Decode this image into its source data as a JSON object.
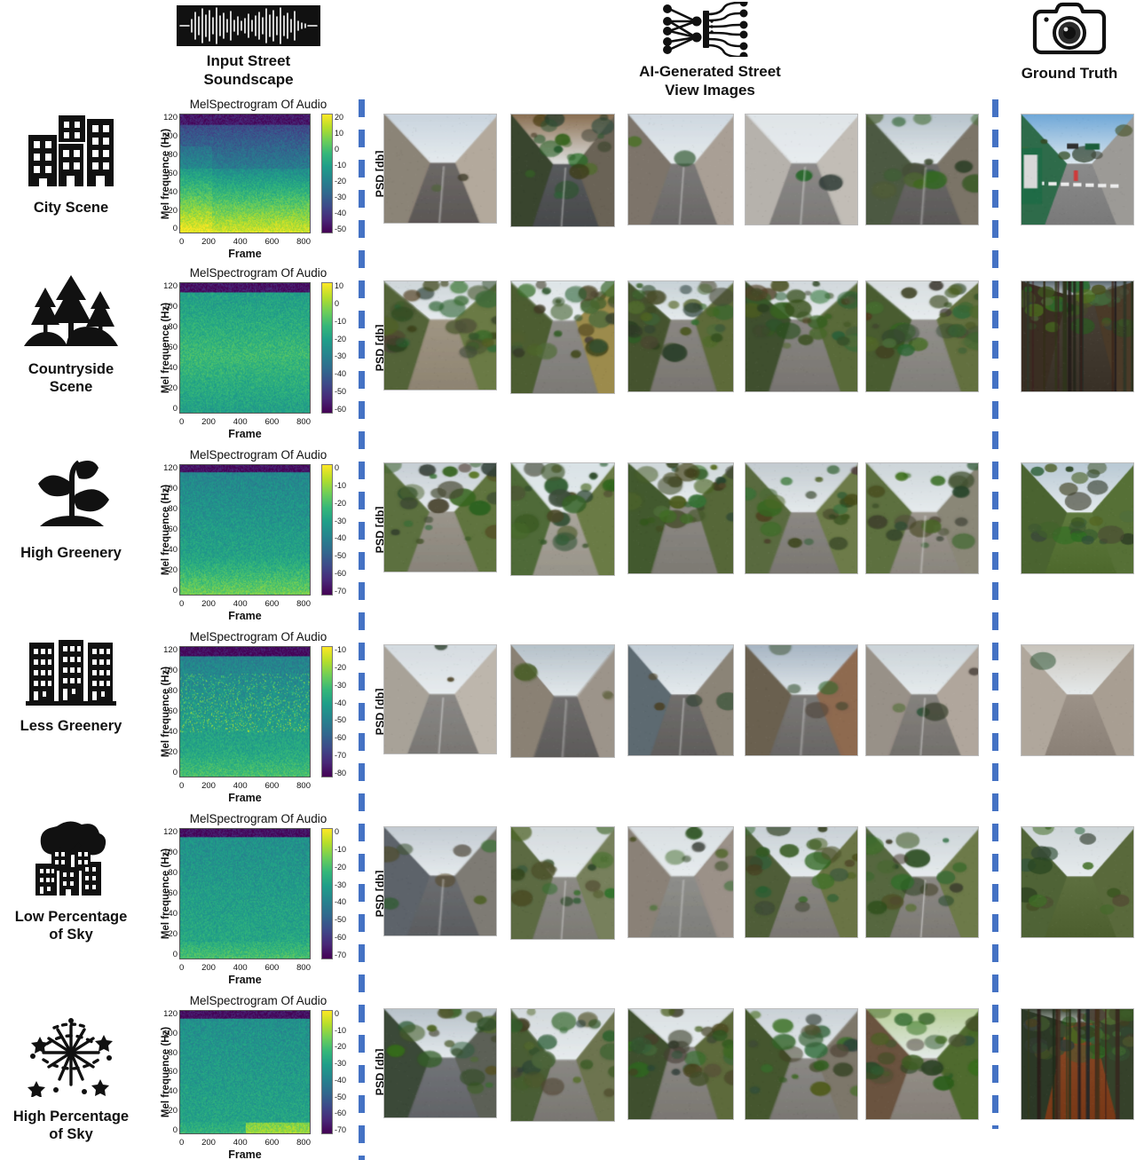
{
  "headers": [
    {
      "id": "input-audio",
      "icon": "audio-waveform-icon",
      "title": "Input Street\nSoundscape"
    },
    {
      "id": "ai-generated",
      "icon": "neural-network-icon",
      "title": "AI-Generated Street\nView Images"
    },
    {
      "id": "ground-truth",
      "icon": "camera-icon",
      "title": "Ground Truth"
    }
  ],
  "spectrogram_common": {
    "title": "MelSpectrogram Of Audio",
    "ylabel": "Mel frequence (Hz)",
    "xlabel": "Frame",
    "cbar_label": "PSD [db]",
    "yticks": [
      "120",
      "100",
      "80",
      "60",
      "40",
      "20",
      "0"
    ],
    "xticks": [
      "0",
      "200",
      "400",
      "600",
      "800"
    ]
  },
  "colors": {
    "divider_blue": "#4472C4",
    "text": "#111111",
    "plot_border": "#555555",
    "viridis_low": "#440154",
    "viridis_high": "#fde725"
  },
  "rows": [
    {
      "id": "city-scene",
      "icon": "city-buildings-icon",
      "label": "City Scene",
      "colorbar_ticks": [
        "20",
        "10",
        "0",
        "-10",
        "-20",
        "-30",
        "-40",
        "-50"
      ],
      "gen_images": [
        "generated-city-street-1",
        "generated-city-street-2",
        "generated-city-street-3",
        "generated-city-street-4",
        "generated-city-street-5"
      ],
      "ground_truth": "ground-truth-city-crosswalk"
    },
    {
      "id": "countryside-scene",
      "icon": "pine-trees-icon",
      "label": "Countryside\nScene",
      "colorbar_ticks": [
        "10",
        "0",
        "-10",
        "-20",
        "-30",
        "-40",
        "-50",
        "-60"
      ],
      "gen_images": [
        "generated-countryside-1",
        "generated-countryside-2",
        "generated-countryside-3",
        "generated-countryside-4",
        "generated-countryside-5"
      ],
      "ground_truth": "ground-truth-forest-path"
    },
    {
      "id": "high-greenery",
      "icon": "sprout-plant-icon",
      "label": "High Greenery",
      "colorbar_ticks": [
        "0",
        "-10",
        "-20",
        "-30",
        "-40",
        "-50",
        "-60",
        "-70"
      ],
      "gen_images": [
        "generated-greenery-1",
        "generated-greenery-2",
        "generated-greenery-3",
        "generated-greenery-4",
        "generated-greenery-5"
      ],
      "ground_truth": "ground-truth-park-lawn"
    },
    {
      "id": "less-greenery",
      "icon": "apartment-blocks-icon",
      "label": "Less Greenery",
      "colorbar_ticks": [
        "-10",
        "-20",
        "-30",
        "-40",
        "-50",
        "-60",
        "-70",
        "-80"
      ],
      "gen_images": [
        "generated-urban-1",
        "generated-urban-2",
        "generated-urban-3",
        "generated-urban-4",
        "generated-urban-5"
      ],
      "ground_truth": "ground-truth-narrow-alley"
    },
    {
      "id": "low-percentage-sky",
      "icon": "tree-and-buildings-icon",
      "label": "Low Percentage\nof Sky",
      "colorbar_ticks": [
        "0",
        "-10",
        "-20",
        "-30",
        "-40",
        "-50",
        "-60",
        "-70"
      ],
      "gen_images": [
        "generated-lowsky-1",
        "generated-lowsky-2",
        "generated-lowsky-3",
        "generated-lowsky-4",
        "generated-lowsky-5"
      ],
      "ground_truth": "ground-truth-overcast-field"
    },
    {
      "id": "high-percentage-sky",
      "icon": "fireworks-icon",
      "label": "High Percentage\nof Sky",
      "colorbar_ticks": [
        "0",
        "-10",
        "-20",
        "-30",
        "-40",
        "-50",
        "-60",
        "-70"
      ],
      "gen_images": [
        "generated-highsky-1",
        "generated-highsky-2",
        "generated-highsky-3",
        "generated-highsky-4",
        "generated-highsky-5"
      ],
      "ground_truth": "ground-truth-bamboo-forest"
    }
  ]
}
